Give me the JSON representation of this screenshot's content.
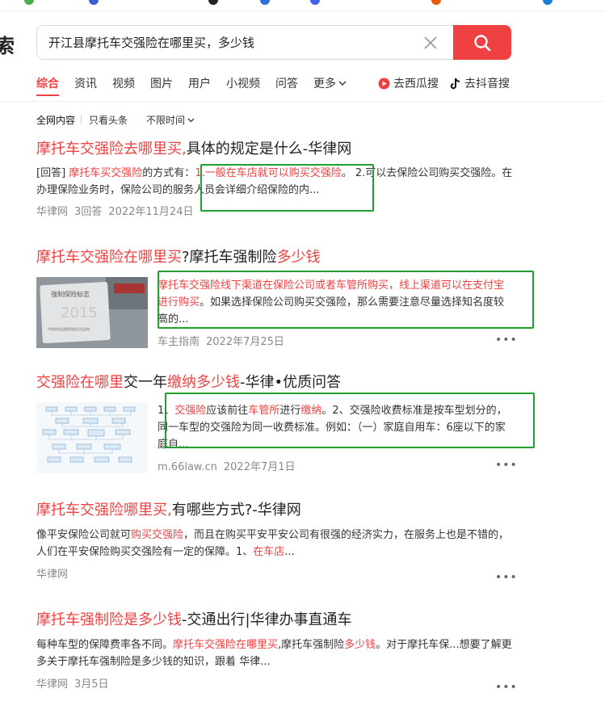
{
  "search": {
    "logo_fragment": "索",
    "query": "开江县摩托车交强险在哪里买，多少钱"
  },
  "tabs": [
    {
      "label": "综合"
    },
    {
      "label": "资讯"
    },
    {
      "label": "视频"
    },
    {
      "label": "图片"
    },
    {
      "label": "用户"
    },
    {
      "label": "小视频"
    },
    {
      "label": "问答"
    },
    {
      "label": "更多"
    }
  ],
  "ext_tabs": [
    {
      "label": "去西瓜搜",
      "color": "#f04142"
    },
    {
      "label": "去抖音搜",
      "color": "#111111"
    }
  ],
  "filters": [
    {
      "label": "全网内容"
    },
    {
      "label": "只看头条"
    },
    {
      "label": "不限时间"
    }
  ],
  "results": [
    {
      "title_hl": "摩托车交强险去哪里买,",
      "title_rest": "具体的规定是什么-华律网",
      "snippet": {
        "prefix": "[回答] ",
        "hl1": "摩托车买交强险",
        "mid": "的方式有：",
        "hl2": "1.一般在车店就可以购买交强险",
        "rest": "。 2.可以去保险公司购买交强险。在办理保险业务时，保险公司的服务人员会详细介绍保险的内..."
      },
      "meta": {
        "source": "华律网",
        "extra": "3回答",
        "date": "2022年11月24日"
      }
    },
    {
      "title_hl": "摩托车交强险在哪里买",
      "title_mid": "?摩托车强制险",
      "title_hl2": "多少钱",
      "thumb": {
        "text1": "強制保险标志",
        "text2": "2015",
        "text3": "中国保险监督管理委员会监制"
      },
      "snippet": {
        "hl": "摩托车交强险线下渠道在保险公司或者车管所购买，线上渠道可以在支付宝进行购买",
        "rest": "。如果选择保险公司购买交强险，那么需要注意尽量选择知名度较高的..."
      },
      "meta": {
        "source": "车主指南",
        "date": "2022年7月25日"
      }
    },
    {
      "title_hl": "交强险在哪里",
      "title_mid": "交一年",
      "title_hl2": "缴纳多少钱",
      "title_rest": "-华律•优质问答",
      "snippet": {
        "p1": "1、",
        "hl1": "交强险",
        "p2": "应该前往",
        "hl2": "车管所",
        "p3": "进行",
        "hl3": "缴纳",
        "rest": "。2、交强险收费标准是按车型划分的，同一车型的交强险为同一收费标准。例如：（一）家庭自用车：6座以下的家庭自..."
      },
      "meta": {
        "source": "m.66law.cn",
        "date": "2022年7月1日"
      }
    },
    {
      "title_hl": "摩托车交强险哪里买,",
      "title_rest": "有哪些方式?-华律网",
      "snippet": {
        "p1": "像平安保险公司就可",
        "hl1": "购买交强险",
        "p2": "，而且在购买平安平安公司有很强的经济实力，在服务上也是不错的，人们在平安保险购买交强险有一定的保障。1、",
        "hl2": "在车店",
        "p3": "..."
      },
      "meta": {
        "source": "华律网"
      }
    },
    {
      "title_hl": "摩托车强制险是多少钱",
      "title_rest": "-交通出行|华律办事直通车",
      "snippet": {
        "p1": "每种车型的保障费率各不同。",
        "hl1": "摩托车交强险在哪里买",
        "p2": ",摩托车强制险",
        "hl2": "多少钱",
        "p3": "。对于摩托车保...想要了解更多关于摩托车强制险是多少钱的知识，跟着 华律..."
      },
      "meta": {
        "source": "华律网",
        "date": "3月5日"
      }
    }
  ],
  "colors": {
    "accent": "#f04142",
    "annotation": "#22a02e"
  }
}
